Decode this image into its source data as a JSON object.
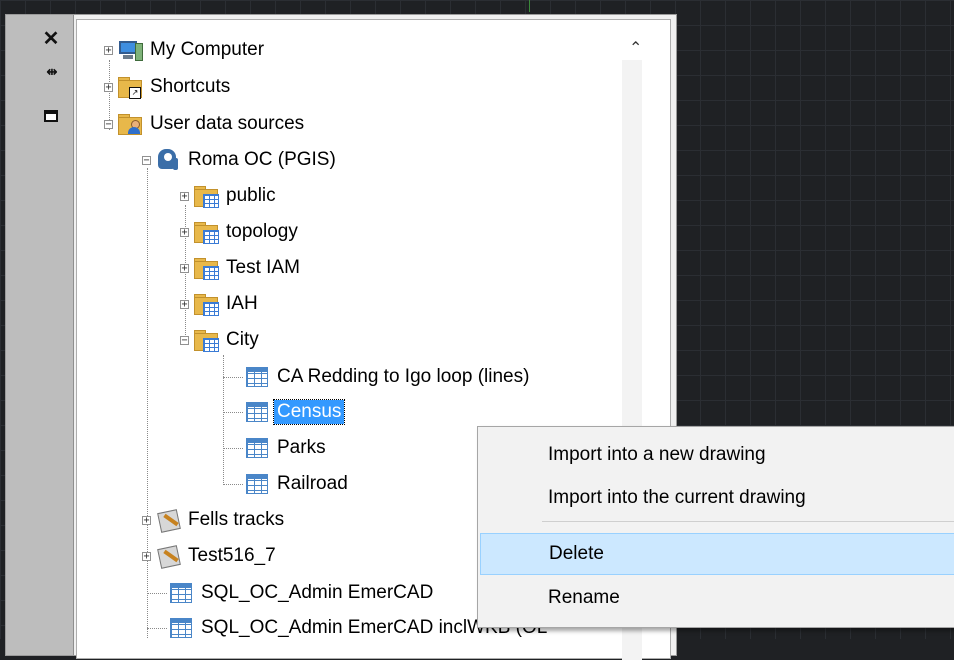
{
  "palette": {
    "close_glyph": "✕",
    "autohide_glyph": "⇹"
  },
  "tree": [
    {
      "label": "My Computer",
      "icon": "computer-icon",
      "expander": "+"
    },
    {
      "label": "Shortcuts",
      "icon": "shortcut-folder-icon",
      "expander": "+"
    },
    {
      "label": "User data sources",
      "icon": "user-folder-icon",
      "expander": "−"
    },
    {
      "label": "Roma OC (PGIS)",
      "icon": "postgresql-elephant-icon",
      "expander": "−"
    },
    {
      "label": "public",
      "icon": "table-folder-icon",
      "expander": "+"
    },
    {
      "label": "topology",
      "icon": "table-folder-icon",
      "expander": "+"
    },
    {
      "label": "Test IAM",
      "icon": "table-folder-icon",
      "expander": "+"
    },
    {
      "label": "IAH",
      "icon": "table-folder-icon",
      "expander": "+"
    },
    {
      "label": "City",
      "icon": "table-folder-icon",
      "expander": "−"
    },
    {
      "label": "CA Redding to Igo loop (lines)",
      "icon": "table-icon"
    },
    {
      "label": "Census",
      "icon": "table-icon",
      "selected": true
    },
    {
      "label": "Parks",
      "icon": "table-icon"
    },
    {
      "label": "Railroad",
      "icon": "table-icon"
    },
    {
      "label": "Fells tracks",
      "icon": "track-data-icon",
      "expander": "+"
    },
    {
      "label": "Test516_7",
      "icon": "track-data-icon",
      "expander": "+"
    },
    {
      "label": "SQL_OC_Admin EmerCAD",
      "icon": "table-icon"
    },
    {
      "label": "SQL_OC_Admin EmerCAD inclWKB (OL",
      "icon": "table-icon"
    }
  ],
  "context_menu": {
    "items": [
      {
        "label": "Import into a new drawing"
      },
      {
        "label": "Import into the current drawing"
      },
      {
        "label": "Delete",
        "highlighted": true
      },
      {
        "label": "Rename"
      }
    ]
  },
  "colors": {
    "selection": "#3399ff",
    "menu_highlight": "#cce8ff",
    "canvas": "#1f2124"
  }
}
